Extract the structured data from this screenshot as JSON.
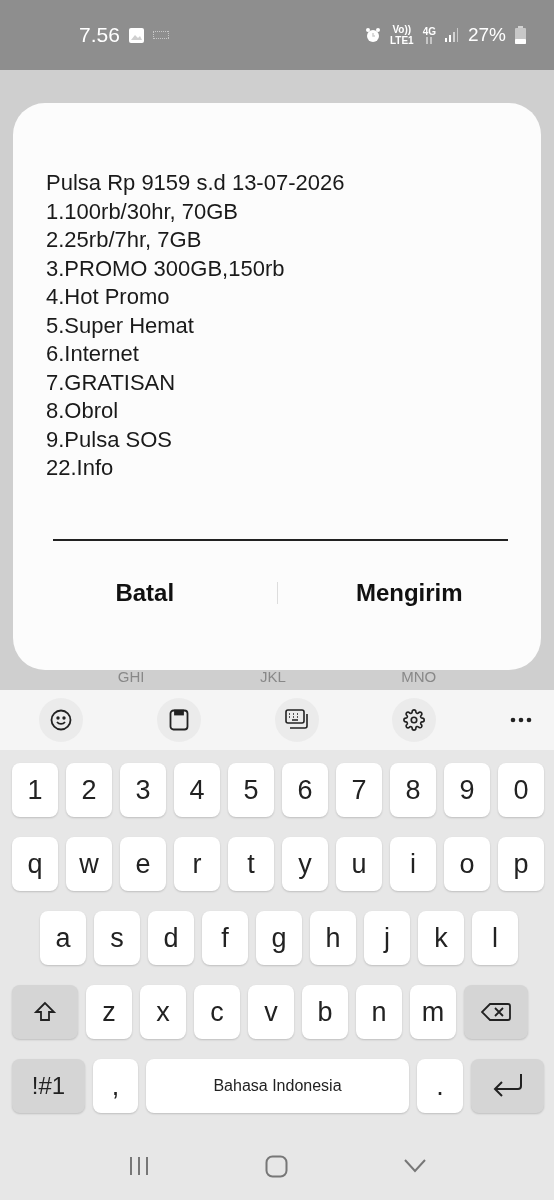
{
  "status_bar": {
    "time": "7.56",
    "volte": "Vo))",
    "lte": "LTE1",
    "network": "4G",
    "battery": "27%"
  },
  "dialog": {
    "lines": [
      "Pulsa Rp 9159 s.d 13-07-2026",
      "1.100rb/30hr, 70GB",
      "2.25rb/7hr, 7GB",
      "3.PROMO 300GB,150rb",
      "4.Hot Promo",
      "5.Super Hemat",
      "6.Internet",
      "7.GRATISAN",
      "8.Obrol",
      "9.Pulsa SOS",
      "22.Info"
    ],
    "buttons": [
      "Batal",
      "Mengirim"
    ]
  },
  "dial_letters": [
    "GHI",
    "JKL",
    "MNO"
  ],
  "keyboard": {
    "number_row": [
      "1",
      "2",
      "3",
      "4",
      "5",
      "6",
      "7",
      "8",
      "9",
      "0"
    ],
    "top_row": [
      "q",
      "w",
      "e",
      "r",
      "t",
      "y",
      "u",
      "i",
      "o",
      "p"
    ],
    "middle_row": [
      "a",
      "s",
      "d",
      "f",
      "g",
      "h",
      "j",
      "k",
      "l"
    ],
    "bottom_row": [
      "z",
      "x",
      "c",
      "v",
      "b",
      "n",
      "m"
    ],
    "symbols_key": "!#1",
    "comma_key": ",",
    "space_key": "Bahasa Indonesia",
    "period_key": "."
  }
}
